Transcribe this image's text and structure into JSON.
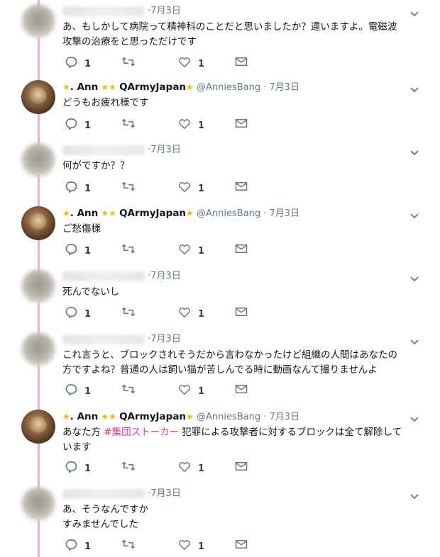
{
  "tweets": [
    {
      "id": "t1",
      "author": "blurred",
      "date": "7月3日",
      "lines": [
        "あ、もしかして病院って精神科のことだと思いましたか？違いますよ。電磁波",
        "攻撃の治療をと思っただけです"
      ],
      "reply_count": "1",
      "like_count": "1"
    },
    {
      "id": "t2",
      "author": "ann",
      "date": "7月3日",
      "lines": [
        "どうもお疲れ様です"
      ],
      "reply_count": "1",
      "like_count": "1"
    },
    {
      "id": "t3",
      "author": "blurred",
      "date": "7月3日",
      "lines": [
        "何がですか？？"
      ],
      "reply_count": "1",
      "like_count": "1"
    },
    {
      "id": "t4",
      "author": "ann",
      "date": "7月3日",
      "lines": [
        "ご愁傷様"
      ],
      "reply_count": "1",
      "like_count": "1"
    },
    {
      "id": "t5",
      "author": "blurred",
      "date": "7月3日",
      "lines": [
        "死んでないし"
      ],
      "reply_count": "1",
      "like_count": "1"
    },
    {
      "id": "t6",
      "author": "blurred",
      "date": "7月3日",
      "lines": [
        "これ言うと、ブロックされそうだから言わなかったけど組織の人間はあなたの",
        "方ですよね？普通の人は飼い猫が苦しんでる時に動画なんて撮りませんよ"
      ],
      "reply_count": "1",
      "like_count": "1"
    },
    {
      "id": "t7",
      "author": "ann",
      "date": "7月3日",
      "line1_pre": "あなた方 ",
      "hashtag": "#集団ストーカー",
      "line1_post": " 犯罪による攻撃者に対するブロックは全て解除して",
      "line2": "います",
      "reply_count": "1",
      "like_count": "1"
    },
    {
      "id": "t8",
      "author": "blurred",
      "date": "7月3日",
      "lines": [
        "あ、そうなんですか",
        "すみませんでした"
      ],
      "reply_count": "1",
      "like_count": "1"
    }
  ],
  "ann_profile": {
    "name_pre": ". Ann",
    "name_post": "QArmyJapan",
    "handle": "@AnniesBang",
    "separator": "·"
  },
  "icons": {
    "reply": "reply-icon",
    "retweet": "retweet-icon",
    "like": "heart-icon",
    "dm": "envelope-icon",
    "caret": "chevron-down-icon",
    "star": "star-emoji"
  },
  "colors": {
    "thread_line": "#e8b4d8",
    "hashtag": "#e0369a",
    "meta": "#657786",
    "star": "#f5b800"
  }
}
